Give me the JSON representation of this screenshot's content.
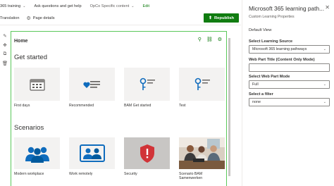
{
  "topnav": {
    "items": [
      {
        "label": "365 training",
        "has_chevron": true
      },
      {
        "label": "Ask questions and get help",
        "has_chevron": false
      },
      {
        "label": "OpCo Specific content",
        "has_chevron": true
      },
      {
        "label": "Edit",
        "has_chevron": false
      }
    ]
  },
  "cmdbar": {
    "translation": "Translation",
    "page_details": "Page details",
    "republish": "Republish"
  },
  "toolrail": [
    "pen-icon",
    "move-icon",
    "copy-icon",
    "trash-icon"
  ],
  "canvas": {
    "title": "Home",
    "sections": [
      {
        "title": "Get started",
        "cards": [
          "First days",
          "Recommended",
          "BAM Get started",
          "Test"
        ]
      },
      {
        "title": "Scenarios",
        "cards": [
          "Modern workplace",
          "Work remotely",
          "Security",
          "Scenario BAM Samenwerken"
        ]
      }
    ]
  },
  "panel": {
    "title": "Microsoft 365 learning path...",
    "subtitle": "Custom Learning Properties",
    "group": "Default View",
    "fields": [
      {
        "label": "Select Learning Source",
        "value": "Microsoft 365 learning pathways",
        "type": "dropdown"
      },
      {
        "label": "Web Part Title (Content Only Mode)",
        "value": "",
        "type": "text"
      },
      {
        "label": "Select Web Part Mode",
        "value": "Full",
        "type": "dropdown"
      },
      {
        "label": "Select a filter",
        "value": "none",
        "type": "dropdown"
      }
    ]
  },
  "colors": {
    "accent_green": "#107c10",
    "canvas_border": "#5ac85a",
    "tile_bg": "#f3f2f1",
    "icon_blue": "#0f6cbd",
    "security_red": "#d13438"
  }
}
